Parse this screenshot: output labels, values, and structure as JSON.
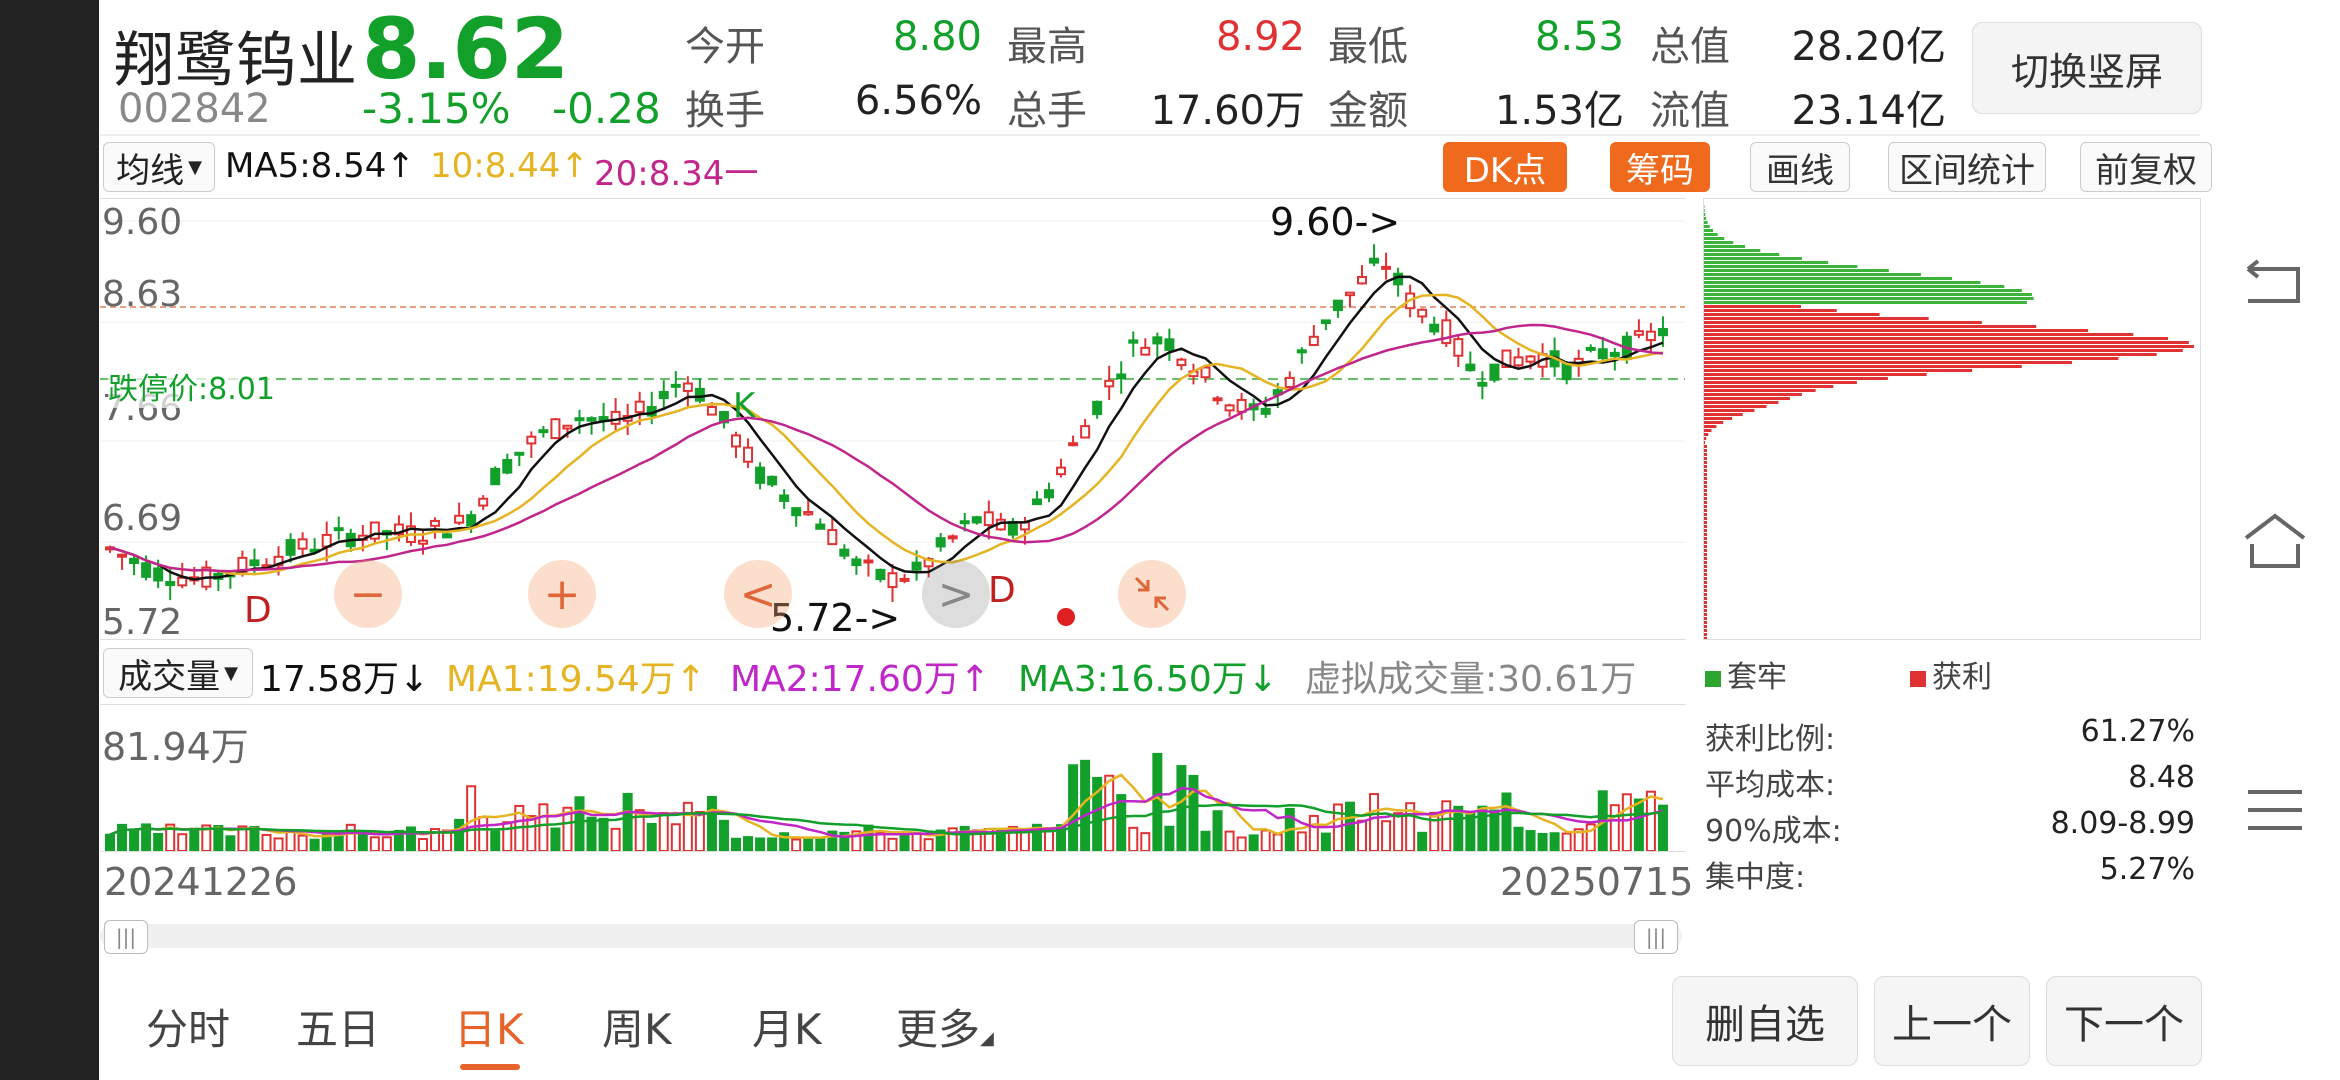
{
  "stock": {
    "name": "翔鹭钨业",
    "price": "8.62",
    "code": "002842",
    "change_pct": "-3.15%",
    "change": "-0.28"
  },
  "quote": [
    {
      "label": "今开",
      "value": "8.80",
      "color": "green"
    },
    {
      "label": "最高",
      "value": "8.92",
      "color": "red"
    },
    {
      "label": "最低",
      "value": "8.53",
      "color": "green"
    },
    {
      "label": "总值",
      "value": "28.20亿",
      "color": "dark"
    },
    {
      "label": "换手",
      "value": "6.56%",
      "color": "dark"
    },
    {
      "label": "总手",
      "value": "17.60万",
      "color": "dark"
    },
    {
      "label": "金额",
      "value": "1.53亿",
      "color": "dark"
    },
    {
      "label": "流值",
      "value": "23.14亿",
      "color": "dark"
    }
  ],
  "toggle_portrait": "切换竖屏",
  "ma_row": {
    "selector": "均线",
    "ma5": "MA5:8.54↑",
    "ma10": "10:8.44↑",
    "ma20": "20:8.34一"
  },
  "toolbar": {
    "dk": "DK点",
    "chip": "筹码",
    "draw": "画线",
    "range_stats": "区间统计",
    "adjust": "前复权"
  },
  "price_axis": [
    "9.60",
    "8.63",
    "7.66",
    "6.69",
    "5.72"
  ],
  "limit_down": "跌停价:8.01",
  "annotations": {
    "high": "9.60->",
    "low": "5.72->",
    "d": "D",
    "k": "K",
    "minus": "−",
    "plus": "+",
    "prev": "<",
    "next": ">"
  },
  "volume_row": {
    "selector": "成交量",
    "vol": "17.58万↓",
    "ma1": "MA1:19.54万↑",
    "ma2": "MA2:17.60万↑",
    "ma3": "MA3:16.50万↓",
    "virtual": "虚拟成交量:30.61万"
  },
  "volume_axis": "81.94万",
  "dates": {
    "start": "20241226",
    "end": "20250715"
  },
  "chip_legend": {
    "trapped": "套牢",
    "profit": "获利"
  },
  "chip_stats": [
    {
      "label": "获利比例:",
      "value": "61.27%"
    },
    {
      "label": "平均成本:",
      "value": "8.48"
    },
    {
      "label": "90%成本:",
      "value": "8.09-8.99"
    },
    {
      "label": "集中度:",
      "value": "5.27%"
    }
  ],
  "tabs": [
    "分时",
    "五日",
    "日K",
    "周K",
    "月K",
    "更多"
  ],
  "active_tab": "日K",
  "bottom_buttons": {
    "remove": "删自选",
    "prev": "上一个",
    "next": "下一个"
  },
  "colors": {
    "up": "#e03232",
    "down": "#12a02a",
    "accent": "#f06a1e",
    "ma5": "#111111",
    "ma10": "#e6b422",
    "ma20": "#c0268c"
  }
}
